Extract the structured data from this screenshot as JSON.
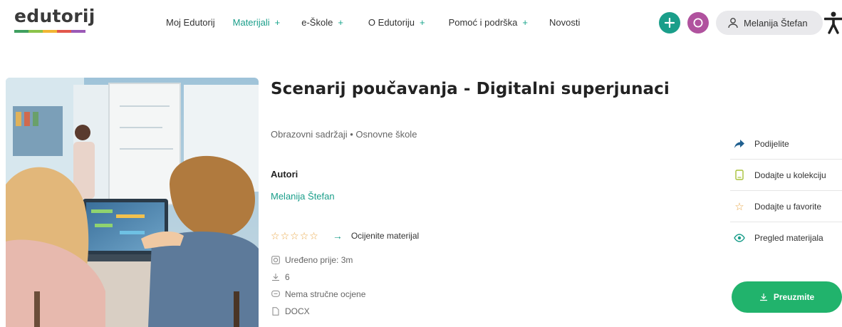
{
  "header": {
    "logo_text": "edutorij",
    "logo_colors": [
      "#3f9f5f",
      "#8bc34a",
      "#f1b533",
      "#e2574c",
      "#9b59b6"
    ],
    "nav": [
      {
        "label": "Moj Edutorij",
        "has_plus": false,
        "active": false
      },
      {
        "label": "Materijali",
        "has_plus": true,
        "active": true
      },
      {
        "label": "e-Škole",
        "has_plus": true,
        "active": false
      },
      {
        "label": "O Edutoriju",
        "has_plus": true,
        "active": false
      },
      {
        "label": "Pomoć i podrška",
        "has_plus": true,
        "active": false
      },
      {
        "label": "Novosti",
        "has_plus": false,
        "active": false
      }
    ],
    "plus_symbol": "+",
    "add_button_color": "#1a9e8a",
    "search_button_color": "#b0529e",
    "user_name": "Melanija Štefan"
  },
  "material": {
    "title": "Scenarij poučavanja - Digitalni superjunaci",
    "category": "Obrazovni sadržaji • Osnovne škole",
    "authors_heading": "Autori",
    "author": "Melanija Štefan",
    "rating_stars": 5,
    "rating_value": 0,
    "rate_label": "Ocijenite materijal",
    "edited": "Uređeno prije: 3m",
    "downloads": "6",
    "expert_review": "Nema stručne ocjene",
    "file_type": "DOCX"
  },
  "actions": {
    "share": "Podijelite",
    "add_collection": "Dodajte u kolekciju",
    "add_favorite": "Dodajte u favorite",
    "preview": "Pregled materijala",
    "download": "Preuzmite"
  },
  "colors": {
    "accent": "#1a9e8a",
    "star": "#e9a84a",
    "download": "#21b36c",
    "collection_icon": "#a8c23a"
  }
}
